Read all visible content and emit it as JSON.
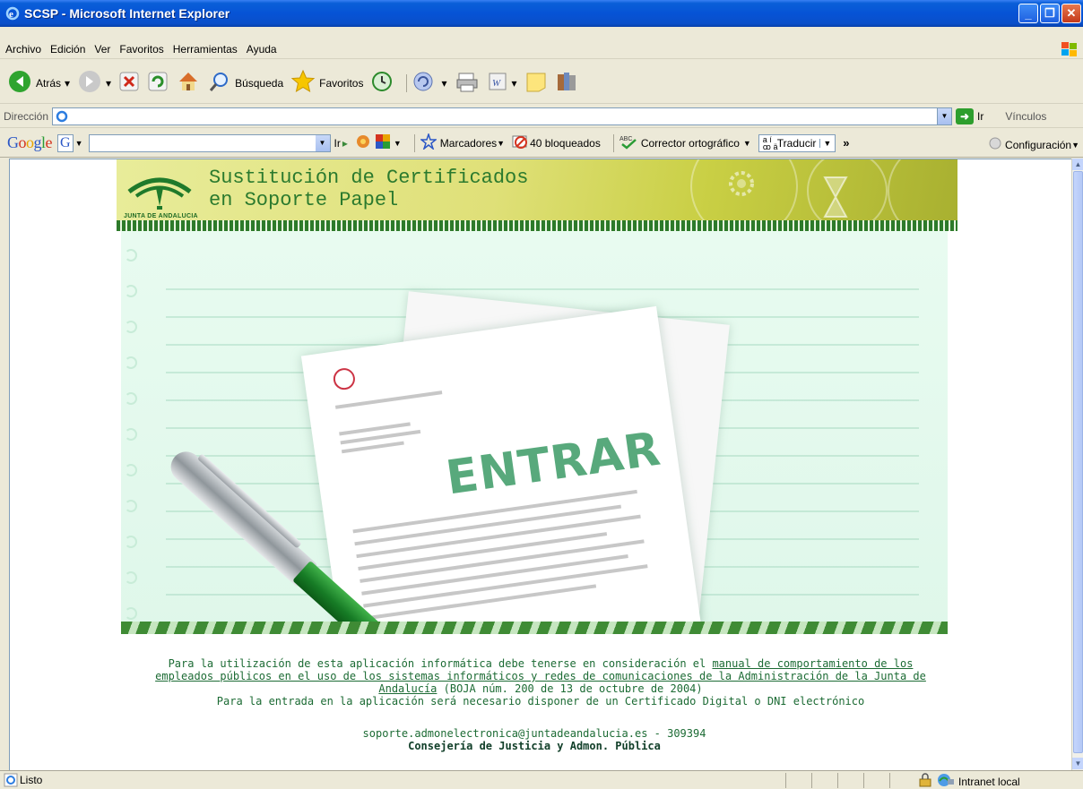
{
  "window": {
    "title": "SCSP - Microsoft Internet Explorer"
  },
  "menu": [
    "Archivo",
    "Edición",
    "Ver",
    "Favoritos",
    "Herramientas",
    "Ayuda"
  ],
  "toolbar": {
    "back": "Atrás",
    "search": "Búsqueda",
    "favorites": "Favoritos"
  },
  "address": {
    "label": "Dirección",
    "value": "",
    "go": "Ir",
    "links": "Vínculos"
  },
  "google": {
    "logo": "Google",
    "search_value": "",
    "go": "Ir",
    "bookmarks": "Marcadores",
    "blocked": "40 bloqueados",
    "spell": "Corrector ortográfico",
    "translate": "Traducir",
    "more": "»",
    "settings": "Configuración"
  },
  "banner": {
    "title_line1": "Sustitución de Certificados",
    "title_line2": "en Soporte Papel",
    "logo_text": "JUNTA DE ANDALUCIA"
  },
  "hero": {
    "enter_label": "ENTRAR"
  },
  "footer": {
    "text_before": "Para la utilización de esta aplicación informática debe tenerse en consideración el ",
    "link": "manual de comportamiento de los empleados públicos en el uso de los sistemas informáticos y redes de comunicaciones de la Administración de la Junta de Andalucía",
    "text_after": " (BOJA núm. 200 de 13 de octubre de 2004)",
    "line2": "Para la entrada en la aplicación será necesario disponer de un Certificado Digital o DNI electrónico",
    "contact": "soporte.admonelectronica@juntadeandalucia.es - 309394",
    "org": "Consejería de Justicia y Admon. Pública"
  },
  "status": {
    "text": "Listo",
    "zone": "Intranet local"
  },
  "colors": {
    "brand_green": "#2b7a2e",
    "title_blue": "#0653d6"
  }
}
